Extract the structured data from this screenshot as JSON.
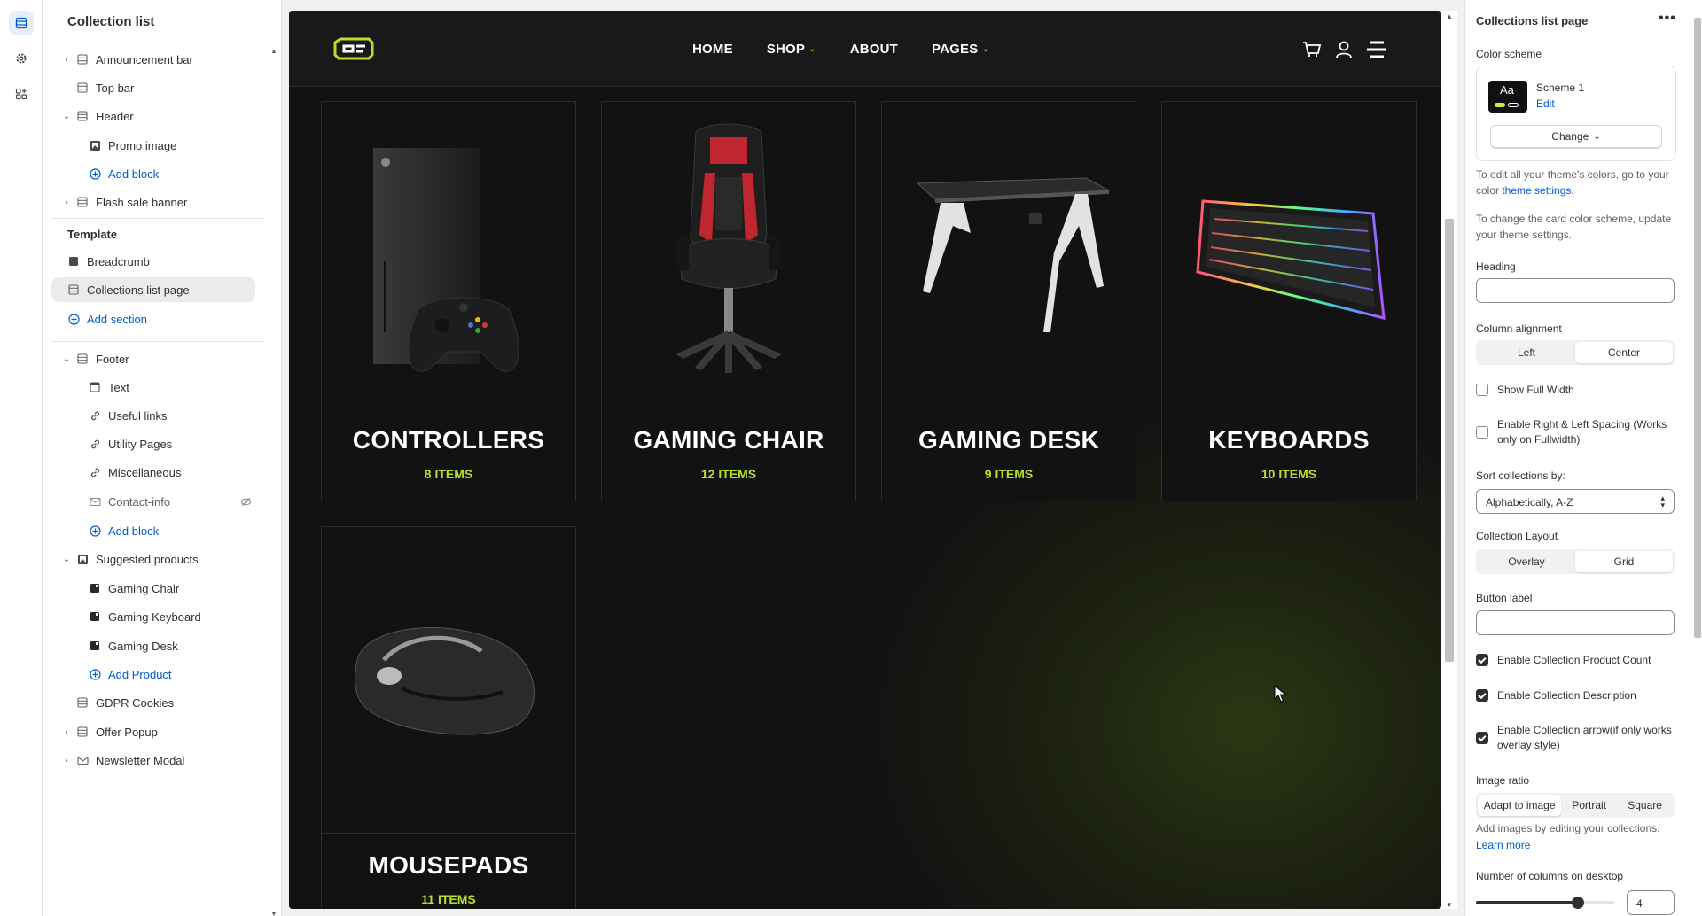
{
  "editor": {
    "sidebar_title": "Collection list",
    "tree": {
      "announcement_bar": "Announcement bar",
      "top_bar": "Top bar",
      "header": "Header",
      "promo_image": "Promo image",
      "add_block_1": "Add block",
      "flash_sale_banner": "Flash sale banner",
      "template_label": "Template",
      "breadcrumb": "Breadcrumb",
      "collections_list_page": "Collections list page",
      "add_section": "Add section",
      "footer": "Footer",
      "text": "Text",
      "useful_links": "Useful links",
      "utility_pages": "Utility Pages",
      "miscellaneous": "Miscellaneous",
      "contact_info": "Contact-info",
      "add_block_2": "Add block",
      "suggested_products": "Suggested products",
      "gaming_chair": "Gaming Chair",
      "gaming_keyboard": "Gaming Keyboard",
      "gaming_desk": "Gaming Desk",
      "add_product": "Add Product",
      "gdpr_cookies": "GDPR Cookies",
      "offer_popup": "Offer Popup",
      "newsletter_modal": "Newsletter Modal"
    }
  },
  "store": {
    "nav": [
      "HOME",
      "SHOP",
      "ABOUT",
      "PAGES"
    ],
    "accent": "#b8e026",
    "collections": [
      {
        "name": "CONTROLLERS",
        "count": "8 ITEMS"
      },
      {
        "name": "GAMING CHAIR",
        "count": "12 ITEMS"
      },
      {
        "name": "GAMING DESK",
        "count": "9 ITEMS"
      },
      {
        "name": "KEYBOARDS",
        "count": "10 ITEMS"
      },
      {
        "name": "MOUSEPADS",
        "count": "11 ITEMS"
      }
    ]
  },
  "settings": {
    "title": "Collections list page",
    "more": "•••",
    "color_scheme_label": "Color scheme",
    "scheme_swatch": "Aa",
    "scheme_name": "Scheme 1",
    "scheme_edit": "Edit",
    "change_btn": "Change",
    "colors_note_a": "To edit all your theme's colors, go to your color ",
    "colors_note_link": "theme settings.",
    "card_note": "To change the card color scheme, update your theme settings.",
    "heading_label": "Heading",
    "heading_value": "",
    "column_alignment_label": "Column alignment",
    "alignment_options": [
      "Left",
      "Center"
    ],
    "alignment_selected": "Center",
    "show_full_width": "Show Full Width",
    "enable_spacing": "Enable Right & Left Spacing (Works only on Fullwidth)",
    "sort_label": "Sort collections by:",
    "sort_value": "Alphabetically, A-Z",
    "layout_label": "Collection Layout",
    "layout_options": [
      "Overlay",
      "Grid"
    ],
    "layout_selected": "Grid",
    "button_label": "Button label",
    "button_value": "",
    "enable_count": "Enable Collection Product Count",
    "enable_description": "Enable Collection Description",
    "enable_arrow": "Enable Collection arrow(if only works overlay style)",
    "image_ratio_label": "Image ratio",
    "ratio_options": [
      "Adapt to image",
      "Portrait",
      "Square"
    ],
    "ratio_selected": "Adapt to image",
    "images_note": "Add images by editing your collections.",
    "learn_more": "Learn more",
    "columns_label": "Number of columns on desktop",
    "columns_value": "4",
    "columns_range": [
      1,
      5
    ],
    "columns_slider_fraction": 0.76
  }
}
